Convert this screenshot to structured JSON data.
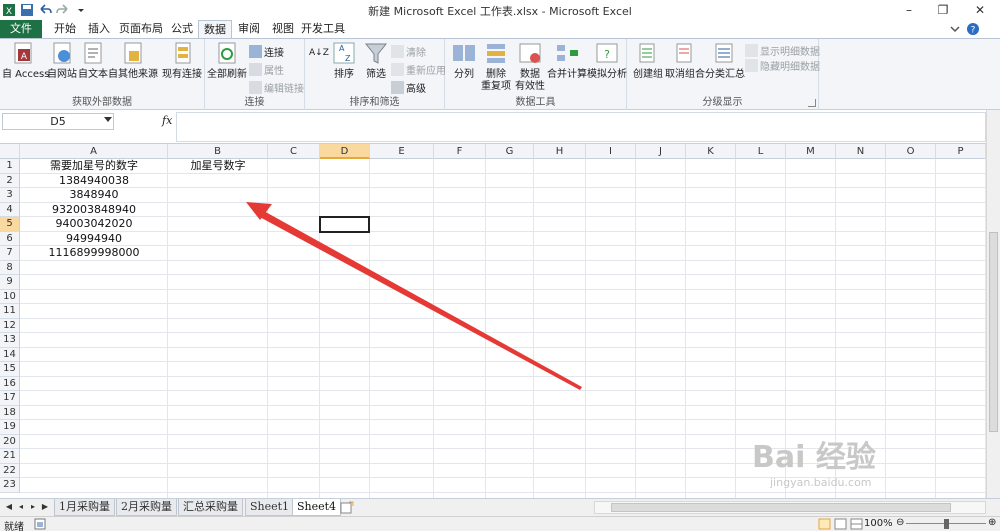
{
  "window": {
    "title": "新建 Microsoft Excel 工作表.xlsx - Microsoft Excel",
    "controls": [
      "–",
      "❐",
      "✕"
    ]
  },
  "tabs": [
    "文件",
    "开始",
    "插入",
    "页面布局",
    "公式",
    "数据",
    "审阅",
    "视图",
    "开发工具"
  ],
  "active_tab": "数据",
  "ribbon": {
    "groups": {
      "external": "获取外部数据",
      "connections": "连接",
      "sort_filter": "排序和筛选",
      "data_tools": "数据工具",
      "outline": "分级显示"
    },
    "buttons": {
      "from_access": "自 Access",
      "from_web": "自网站",
      "from_text": "自文本",
      "from_other": "自其他来源",
      "existing_conn": "现有连接",
      "refresh_all": "全部刷新",
      "connections": "连接",
      "properties": "属性",
      "edit_links": "编辑链接",
      "sort_az": "A↓Z",
      "sort": "排序",
      "filter": "筛选",
      "clear": "清除",
      "reapply": "重新应用",
      "advanced": "高级",
      "text_to_cols": "分列",
      "remove_dup_1": "删除",
      "remove_dup_2": "重复项",
      "validation_1": "数据",
      "validation_2": "有效性",
      "consolidate": "合并计算",
      "what_if": "模拟分析",
      "group": "创建组",
      "ungroup": "取消组合",
      "subtotal": "分类汇总",
      "show_detail": "显示明细数据",
      "hide_detail": "隐藏明细数据"
    }
  },
  "formula_bar": {
    "name_box": "D5",
    "fx": "fx",
    "value": ""
  },
  "columns": [
    "A",
    "B",
    "C",
    "D",
    "E",
    "F",
    "G",
    "H",
    "I",
    "J",
    "K",
    "L",
    "M",
    "N",
    "O",
    "P"
  ],
  "rows": [
    "1",
    "2",
    "3",
    "4",
    "5",
    "6",
    "7",
    "8",
    "9",
    "10",
    "11",
    "12",
    "13",
    "14",
    "15",
    "16",
    "17",
    "18",
    "19",
    "20",
    "21",
    "22",
    "23"
  ],
  "selected_column": "D",
  "selected_row": "5",
  "cells": {
    "A1": "需要加星号的数字",
    "B1": "加星号数字",
    "A2": "1384940038",
    "A3": "3848940",
    "A4": "932003848940",
    "A5": "94003042020",
    "A6": "94994940",
    "A7": "1116899998000"
  },
  "sheets": [
    "1月采购量",
    "2月采购量",
    "汇总采购量",
    "Sheet1",
    "Sheet4"
  ],
  "active_sheet": "Sheet4",
  "status": {
    "ready": "就绪",
    "zoom": "100%"
  },
  "annotation_color": "#e53935",
  "watermark": {
    "main": "Bai 经验",
    "sub": "jingyan.baidu.com"
  }
}
